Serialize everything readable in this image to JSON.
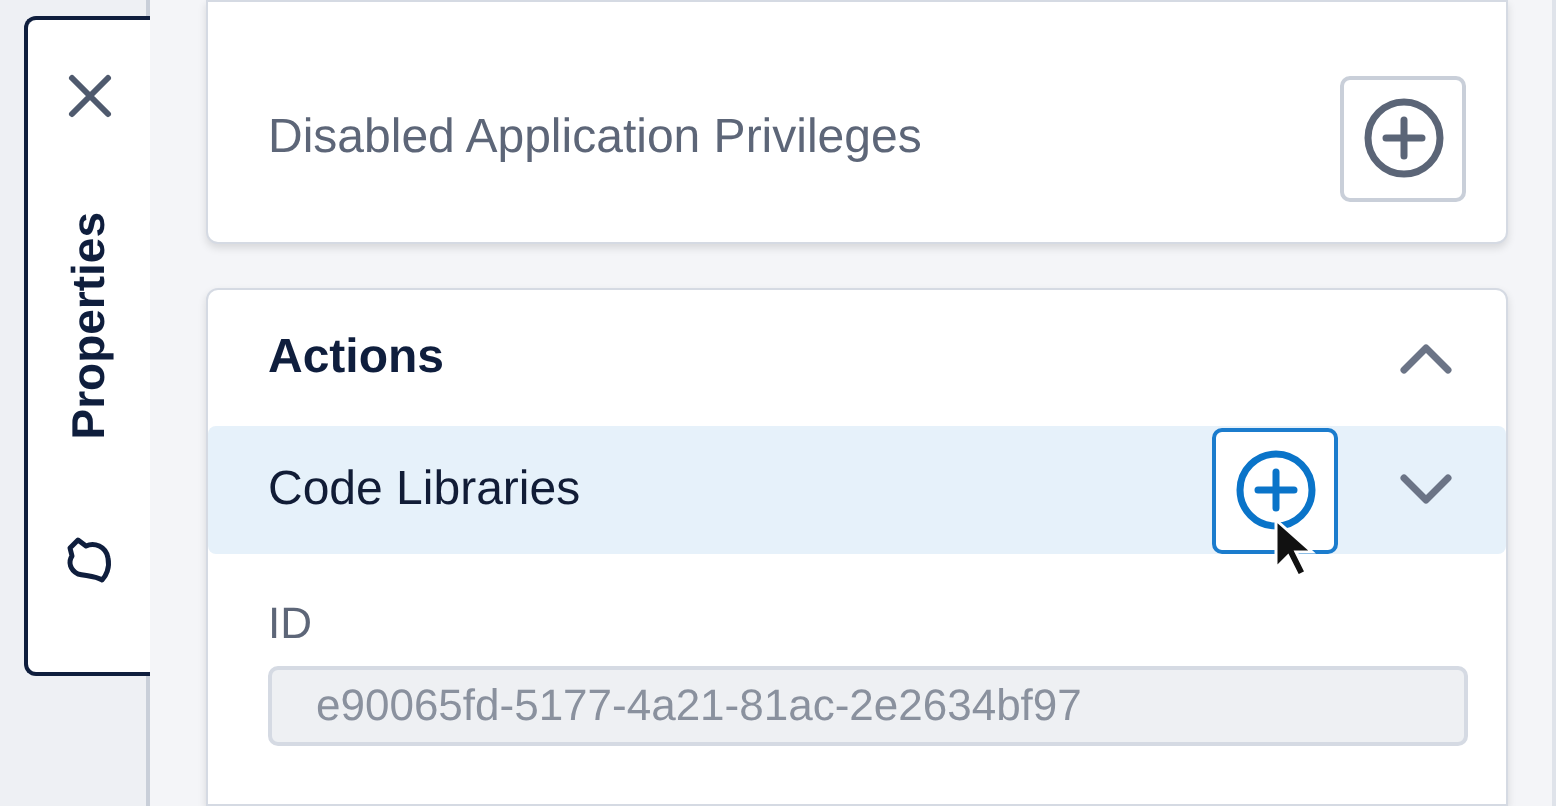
{
  "side_tab": {
    "label": "Properties",
    "selected": true
  },
  "features": {
    "rows": [
      {
        "label": "Disabled Application Privileges",
        "hovered": false
      }
    ]
  },
  "actions": {
    "title": "Actions",
    "expanded": true,
    "rows": [
      {
        "label": "Code Libraries",
        "selected": true,
        "hovered": true,
        "expanded": false
      }
    ],
    "field": {
      "label": "ID",
      "value": "e90065fd-5177-4a21-81ac-2e2634bf97",
      "disabled": true
    }
  }
}
